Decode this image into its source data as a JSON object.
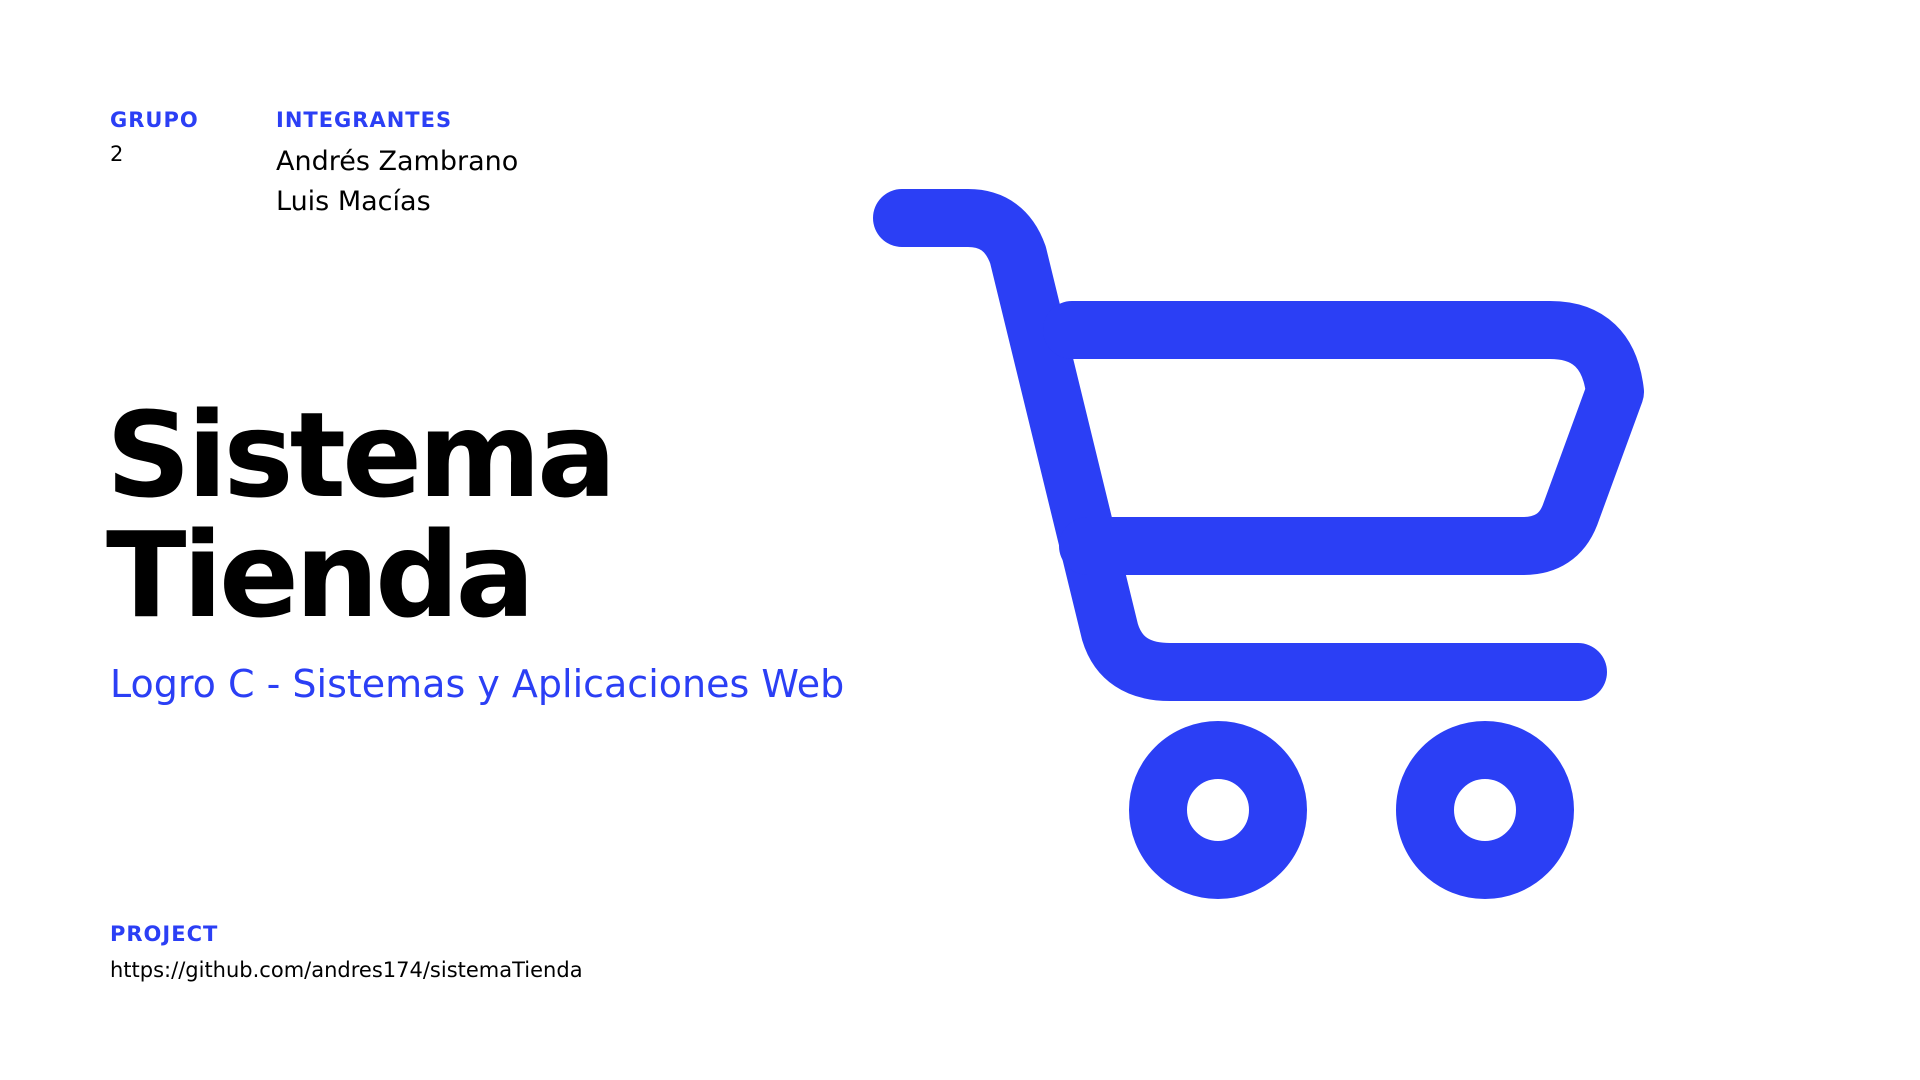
{
  "group": {
    "label": "GRUPO",
    "value": "2"
  },
  "members": {
    "label": "INTEGRANTES",
    "names": [
      "Andrés Zambrano",
      "Luis Macías"
    ]
  },
  "title": {
    "line1": "Sistema",
    "line2": "Tienda"
  },
  "subtitle": "Logro C -  Sistemas y Aplicaciones Web",
  "project": {
    "label": "PROJECT",
    "url": "https://github.com/andres174/sistemaTienda"
  },
  "colors": {
    "accent": "#2b3ff5",
    "text": "#000000",
    "background": "#ffffff"
  },
  "icons": {
    "cart": "shopping-cart-icon"
  }
}
